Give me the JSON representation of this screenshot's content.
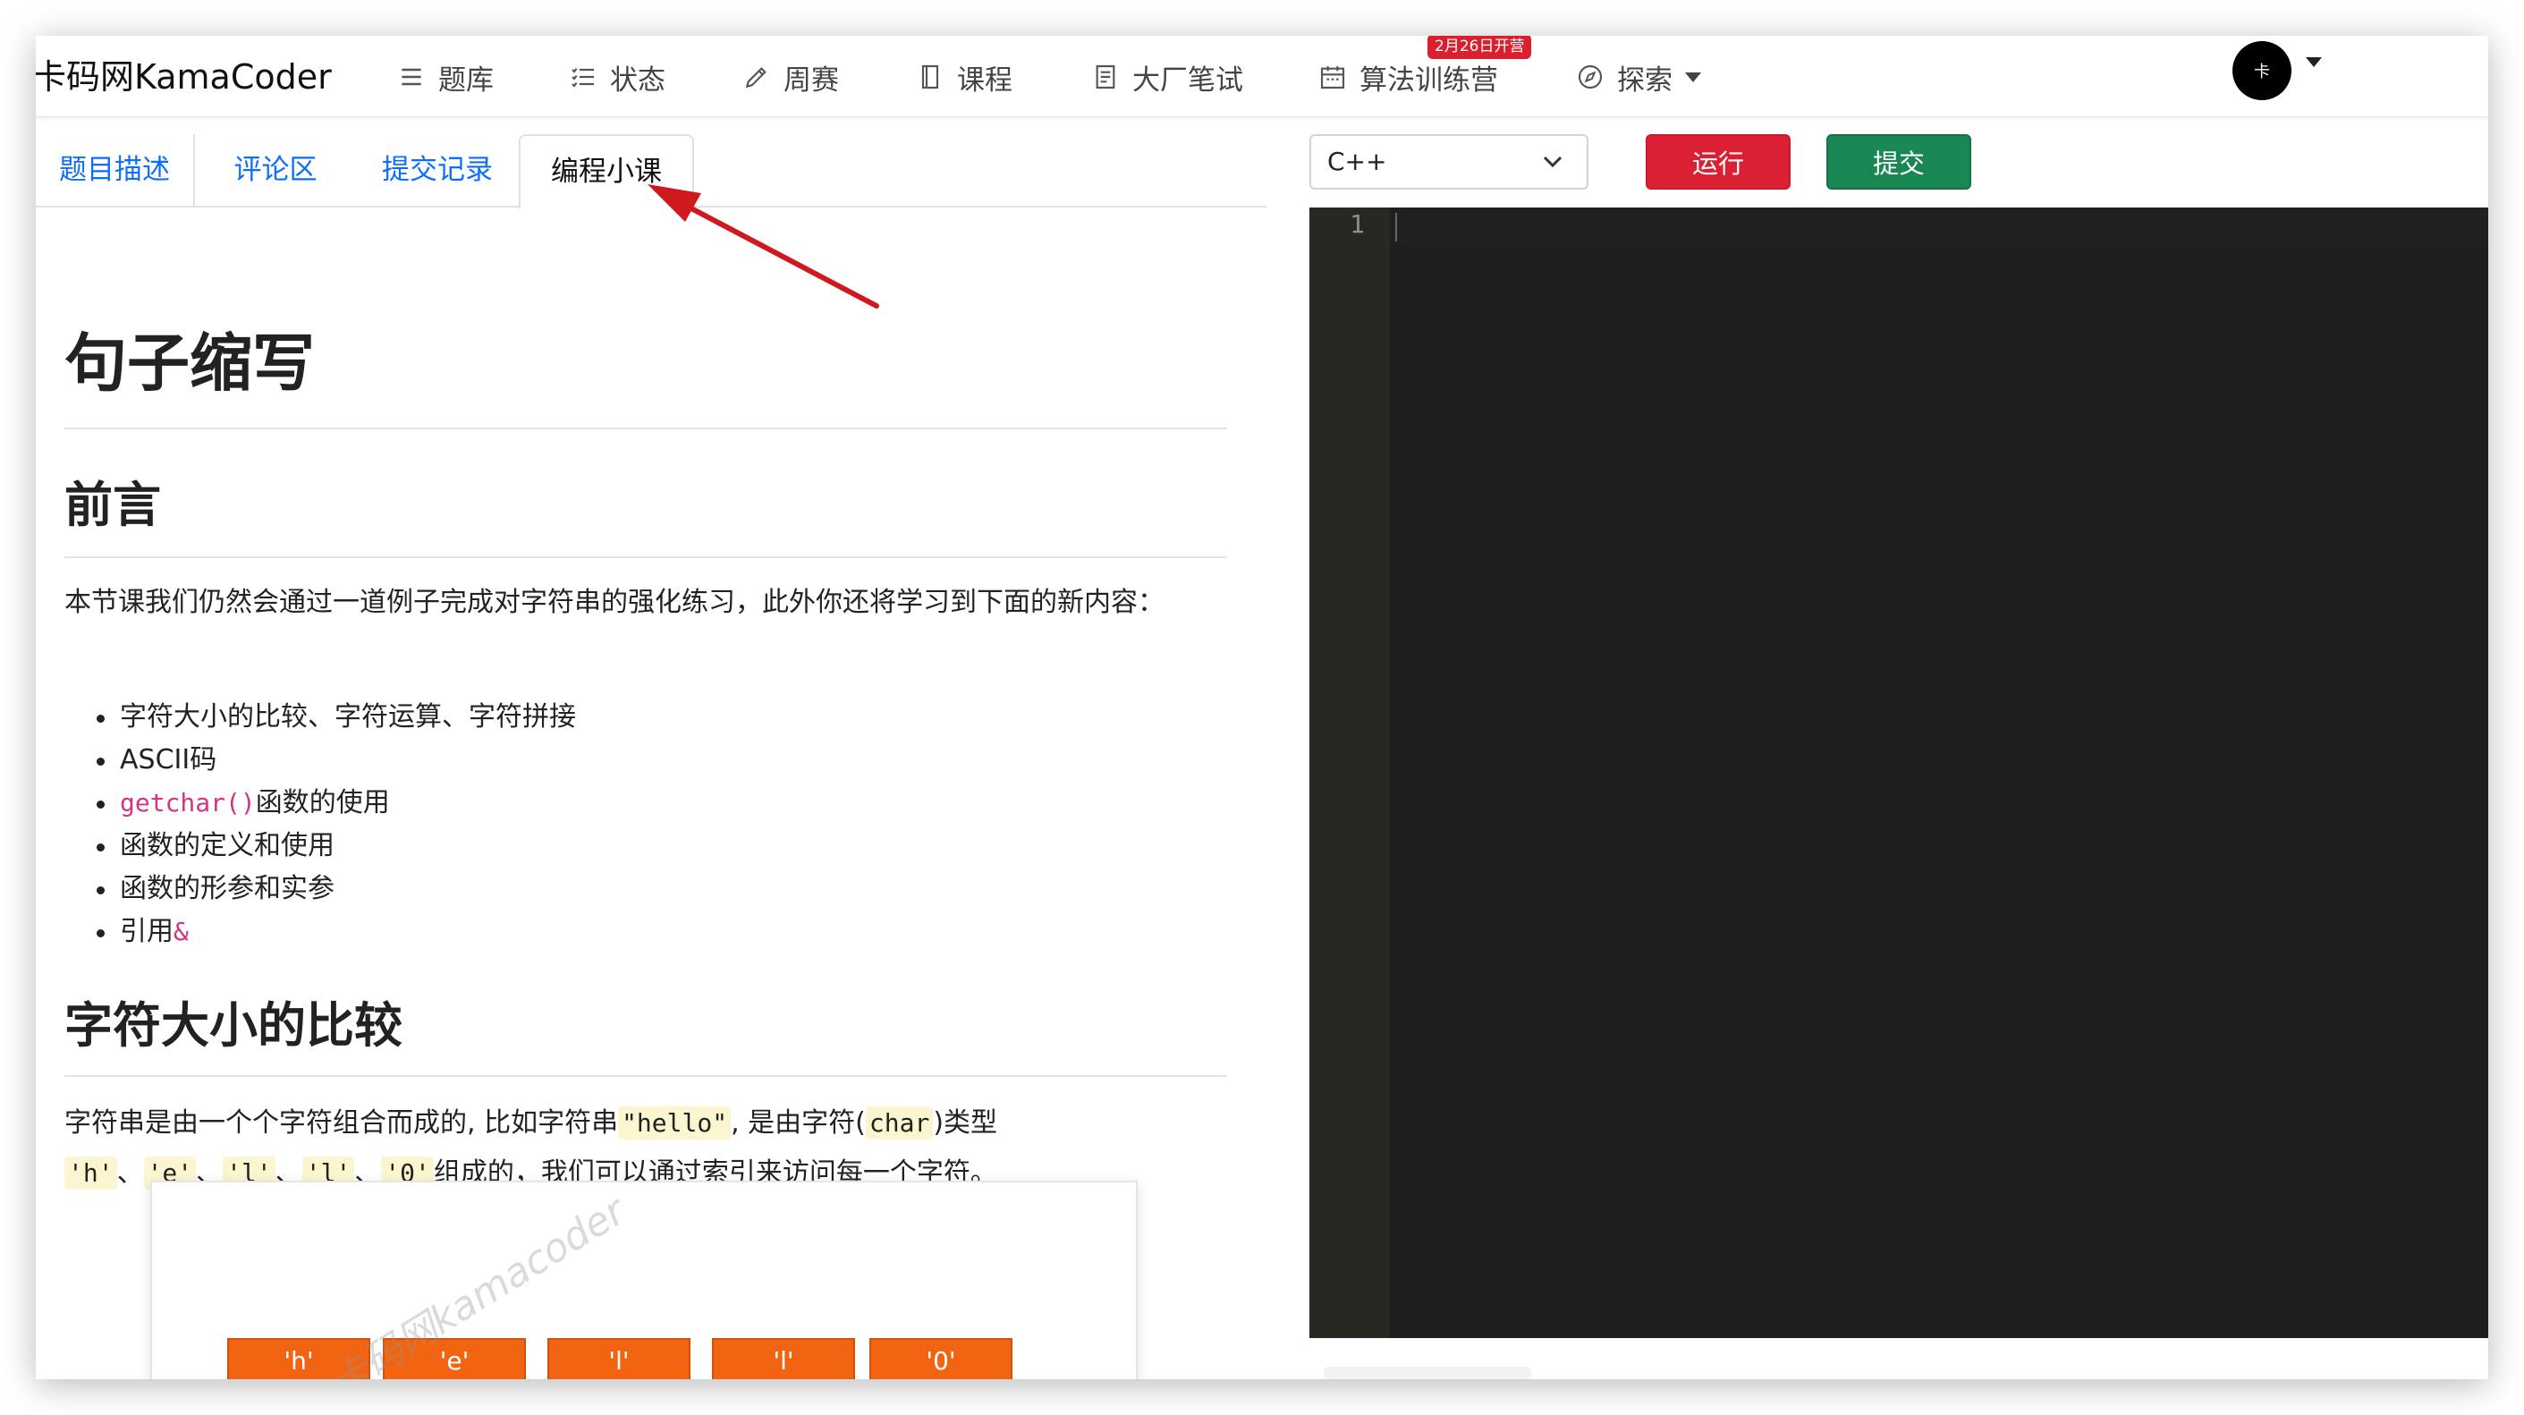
{
  "brand": "卡码网KamaCoder",
  "nav": {
    "items": [
      {
        "label": "题库",
        "icon": "list-icon"
      },
      {
        "label": "状态",
        "icon": "checklist-icon"
      },
      {
        "label": "周赛",
        "icon": "pencil-icon"
      },
      {
        "label": "课程",
        "icon": "book-icon"
      },
      {
        "label": "大厂笔试",
        "icon": "document-icon"
      },
      {
        "label": "算法训练营",
        "icon": "calendar-icon"
      },
      {
        "label": "探索",
        "icon": "compass-icon"
      }
    ],
    "camp_badge": "2月26日开营",
    "avatar_text": "卡"
  },
  "tabs": [
    {
      "label": "题目描述"
    },
    {
      "label": "评论区"
    },
    {
      "label": "提交记录"
    },
    {
      "label": "编程小课"
    }
  ],
  "article": {
    "title": "句子缩写",
    "section1": {
      "heading": "前言",
      "intro": "本节课我们仍然会通过一道例子完成对字符串的强化练习，此外你还将学习到下面的新内容：",
      "bullets": {
        "b1": "字符大小的比较、字符运算、字符拼接",
        "b2": "ASCII码",
        "b3_code": "getchar()",
        "b3_text": "函数的使用",
        "b4": "函数的定义和使用",
        "b5": "函数的形参和实参",
        "b6_text": "引用",
        "b6_code": "&"
      }
    },
    "section2": {
      "heading": "字符大小的比较",
      "p1": "字符串是由一个个字符组合而成的, 比如字符串",
      "p1_code": "\"hello\"",
      "p2": ", 是由字符(",
      "p2_code": "char",
      "p3": ")类型",
      "chars": [
        "'h'",
        "'e'",
        "'l'",
        "'l'",
        "'0'"
      ],
      "sep": "、",
      "p4": "组成的，我们可以通过索引来访问每一个字符。"
    },
    "diagram": {
      "cells": [
        "'h'",
        "'e'",
        "'l'",
        "'l'",
        "'0'"
      ],
      "watermark": "卡码网kamacoder"
    }
  },
  "editor": {
    "language": "C++",
    "run_label": "运行",
    "submit_label": "提交",
    "line_number": "1",
    "colors": {
      "background": "#1e1f1c",
      "gutter": "#272822"
    }
  },
  "colors": {
    "link": "#0d6efd",
    "run": "#dc2033",
    "submit": "#198754",
    "arrow": "#d0191f",
    "diagram_cell": "#f16512"
  }
}
